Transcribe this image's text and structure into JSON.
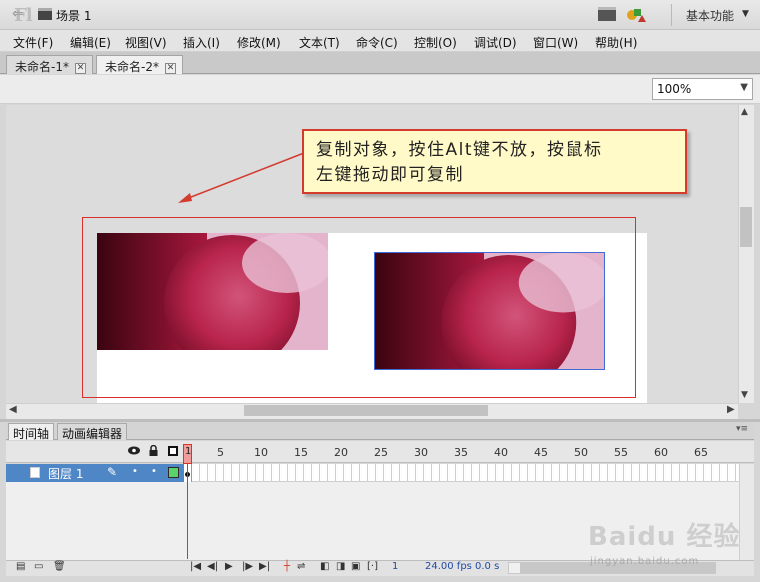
{
  "app": {
    "logo": "Fl"
  },
  "workspace": {
    "label": "基本功能"
  },
  "menu": [
    "文件(F)",
    "编辑(E)",
    "视图(V)",
    "插入(I)",
    "修改(M)",
    "文本(T)",
    "命令(C)",
    "控制(O)",
    "调试(D)",
    "窗口(W)",
    "帮助(H)"
  ],
  "tabs": [
    {
      "label": "未命名-1*",
      "active": false
    },
    {
      "label": "未命名-2*",
      "active": true
    }
  ],
  "editbar": {
    "scene_label": "场景 1",
    "zoom": "100%"
  },
  "callout": {
    "line1": "复制对象，按住Alt键不放，按鼠标",
    "line2": "左键拖动即可复制"
  },
  "timeline": {
    "tabs": [
      "时间轴",
      "动画编辑器"
    ],
    "ruler": [
      "1",
      "5",
      "10",
      "15",
      "20",
      "25",
      "30",
      "35",
      "40",
      "45",
      "50",
      "55",
      "60",
      "65"
    ],
    "layer": {
      "name": "图层 1"
    },
    "footer": {
      "frame": "1",
      "fps": "24.00 fps",
      "time": "0.0 s"
    }
  },
  "watermark": {
    "brand": "Baidu 经验",
    "url": "jingyan.baidu.com"
  },
  "colors": {
    "annotation_red": "#d33b2e",
    "callout_bg": "#fffac8",
    "selection_blue": "#3f6bd8",
    "layer_highlight": "#4f86c6",
    "layer_color_swatch": "#5cd16b"
  }
}
